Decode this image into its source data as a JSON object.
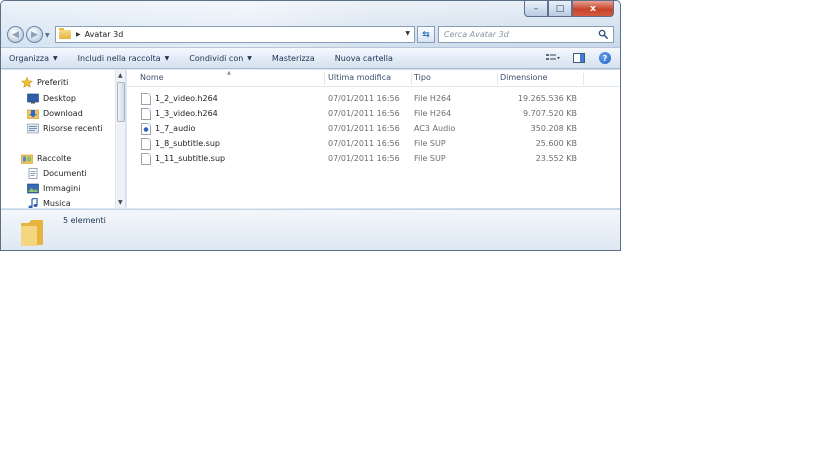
{
  "window": {
    "address": "Avatar 3d",
    "search_placeholder": "Cerca Avatar 3d",
    "controls": {
      "minimize": "–",
      "maximize": "□",
      "close": "x"
    }
  },
  "toolbar": {
    "organize": "Organizza",
    "include": "Includi nella raccolta",
    "share": "Condividi con",
    "burn": "Masterizza",
    "new_folder": "Nuova cartella"
  },
  "nav": {
    "favorites": "Preferiti",
    "desktop": "Desktop",
    "download": "Download",
    "recent": "Risorse recenti",
    "libraries": "Raccolte",
    "documents": "Documenti",
    "images": "Immagini",
    "music": "Musica"
  },
  "columns": {
    "name": "Nome",
    "modified": "Ultima modifica",
    "type": "Tipo",
    "size": "Dimensione"
  },
  "files": [
    {
      "name": "1_2_video.h264",
      "modified": "07/01/2011 16:56",
      "type": "File H264",
      "size": "19.265.536 KB",
      "icon": "file-icon"
    },
    {
      "name": "1_3_video.h264",
      "modified": "07/01/2011 16:56",
      "type": "File H264",
      "size": "9.707.520 KB",
      "icon": "file-icon"
    },
    {
      "name": "1_7_audio",
      "modified": "07/01/2011 16:56",
      "type": "AC3 Audio",
      "size": "350.208 KB",
      "icon": "audio-file-icon"
    },
    {
      "name": "1_8_subtitle.sup",
      "modified": "07/01/2011 16:56",
      "type": "File SUP",
      "size": "25.600 KB",
      "icon": "file-icon"
    },
    {
      "name": "1_11_subtitle.sup",
      "modified": "07/01/2011 16:56",
      "type": "File SUP",
      "size": "23.552 KB",
      "icon": "file-icon"
    }
  ],
  "status": {
    "count": "5 elementi"
  },
  "colors": {
    "accent": "#2f6fc4",
    "toolbar_text": "#1e3251",
    "close_red": "#c7442a"
  }
}
